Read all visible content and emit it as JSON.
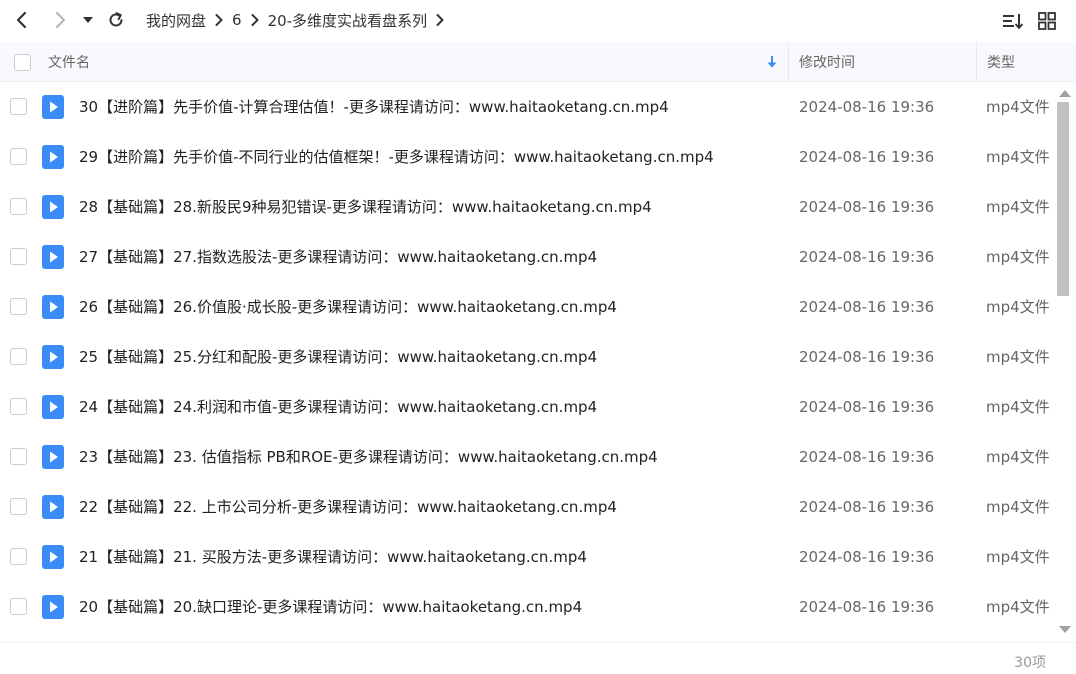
{
  "breadcrumb": [
    "我的网盘",
    "6",
    "20-多维度实战看盘系列"
  ],
  "columns": {
    "name": "文件名",
    "modified": "修改时间",
    "type": "类型"
  },
  "files": [
    {
      "name": "30【进阶篇】先手价值-计算合理估值！-更多课程请访问：www.haitaoketang.cn.mp4",
      "modified": "2024-08-16 19:36",
      "type": "mp4文件"
    },
    {
      "name": "29【进阶篇】先手价值-不同行业的估值框架！-更多课程请访问：www.haitaoketang.cn.mp4",
      "modified": "2024-08-16 19:36",
      "type": "mp4文件"
    },
    {
      "name": "28【基础篇】28.新股民9种易犯错误-更多课程请访问：www.haitaoketang.cn.mp4",
      "modified": "2024-08-16 19:36",
      "type": "mp4文件"
    },
    {
      "name": "27【基础篇】27.指数选股法-更多课程请访问：www.haitaoketang.cn.mp4",
      "modified": "2024-08-16 19:36",
      "type": "mp4文件"
    },
    {
      "name": "26【基础篇】26.价值股·成长股-更多课程请访问：www.haitaoketang.cn.mp4",
      "modified": "2024-08-16 19:36",
      "type": "mp4文件"
    },
    {
      "name": "25【基础篇】25.分红和配股-更多课程请访问：www.haitaoketang.cn.mp4",
      "modified": "2024-08-16 19:36",
      "type": "mp4文件"
    },
    {
      "name": "24【基础篇】24.利润和市值-更多课程请访问：www.haitaoketang.cn.mp4",
      "modified": "2024-08-16 19:36",
      "type": "mp4文件"
    },
    {
      "name": "23【基础篇】23. 估值指标 PB和ROE-更多课程请访问：www.haitaoketang.cn.mp4",
      "modified": "2024-08-16 19:36",
      "type": "mp4文件"
    },
    {
      "name": "22【基础篇】22. 上市公司分析-更多课程请访问：www.haitaoketang.cn.mp4",
      "modified": "2024-08-16 19:36",
      "type": "mp4文件"
    },
    {
      "name": "21【基础篇】21. 买股方法-更多课程请访问：www.haitaoketang.cn.mp4",
      "modified": "2024-08-16 19:36",
      "type": "mp4文件"
    },
    {
      "name": "20【基础篇】20.缺口理论-更多课程请访问：www.haitaoketang.cn.mp4",
      "modified": "2024-08-16 19:36",
      "type": "mp4文件"
    }
  ],
  "footer": {
    "count": "30项"
  },
  "icons": {
    "back": "chevron-left-icon",
    "forward": "chevron-right-icon",
    "history": "caret-down-icon",
    "refresh": "refresh-icon",
    "sort": "sort-list-icon",
    "grid": "grid-view-icon",
    "file": "video-file-icon",
    "sort_dir": "arrow-down-icon"
  },
  "colors": {
    "accent": "#3b8cf6",
    "header_bg": "#f7f9fc",
    "text": "#222222",
    "muted": "#666666"
  }
}
